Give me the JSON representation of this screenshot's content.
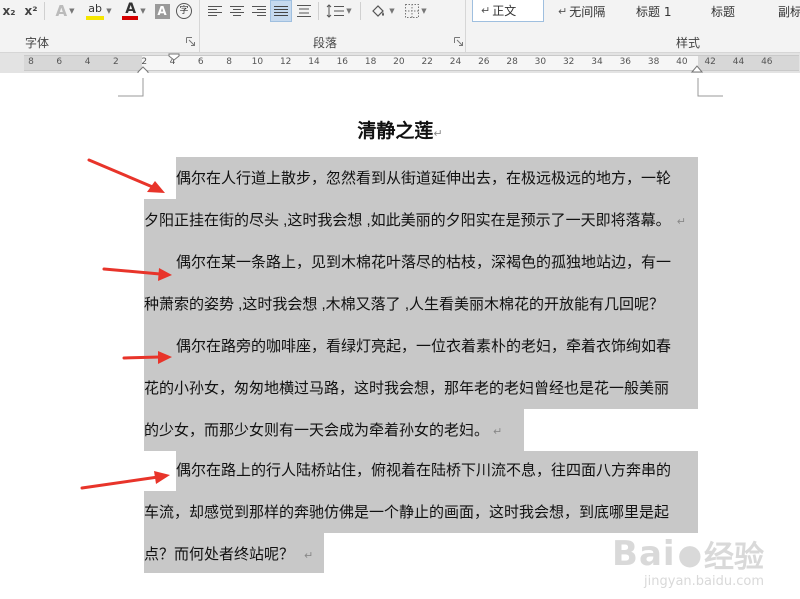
{
  "ribbon": {
    "subscript_label": "x₂",
    "superscript_label": "x²",
    "font_group_label": "字体",
    "paragraph_group_label": "段落",
    "styles_group_label": "样式",
    "phonetic_label": "字",
    "styles": [
      "正文",
      "无间隔",
      "标题 1",
      "标题",
      "副标"
    ],
    "highlight_color": "#f5e600",
    "font_color": "#d40000"
  },
  "ruler": {
    "numbers": [
      "8",
      "6",
      "4",
      "2",
      "2",
      "4",
      "6",
      "8",
      "10",
      "12",
      "14",
      "16",
      "18",
      "20",
      "22",
      "24",
      "26",
      "28",
      "30",
      "32",
      "34",
      "36",
      "38",
      "40",
      "42",
      "44",
      "46"
    ]
  },
  "document": {
    "title": "清静之莲",
    "para_mark": "↵",
    "paragraphs": [
      {
        "lines": [
          "偶尔在人行道上散步，忽然看到从街道延伸出去，在极远极远的地方，一轮",
          "夕阳正挂在街的尽头 ,这时我会想 ,如此美丽的夕阳实在是预示了一天即将落幕。"
        ]
      },
      {
        "lines": [
          "偶尔在某一条路上，见到木棉花叶落尽的枯枝，深褐色的孤独地站边，有一",
          "种萧索的姿势 ,这时我会想 ,木棉又落了 ,人生看美丽木棉花的开放能有几回呢？"
        ]
      },
      {
        "lines": [
          "偶尔在路旁的咖啡座，看绿灯亮起，一位衣着素朴的老妇，牵着衣饰绚如春",
          "花的小孙女，匆匆地横过马路，这时我会想，那年老的老妇曾经也是花一般美丽",
          "的少女，而那少女则有一天会成为牵着孙女的老妇。"
        ]
      },
      {
        "lines": [
          "偶尔在路上的行人陆桥站住，俯视着在陆桥下川流不息，往四面八方奔串的",
          "车流，却感觉到那样的奔驰仿佛是一个静止的画面，这时我会想，到底哪里是起",
          "点？而何处者终站呢？"
        ]
      }
    ]
  },
  "watermark": {
    "brand": "Bai",
    "brand_cn": "经验",
    "url": "jingyan.baidu.com"
  }
}
